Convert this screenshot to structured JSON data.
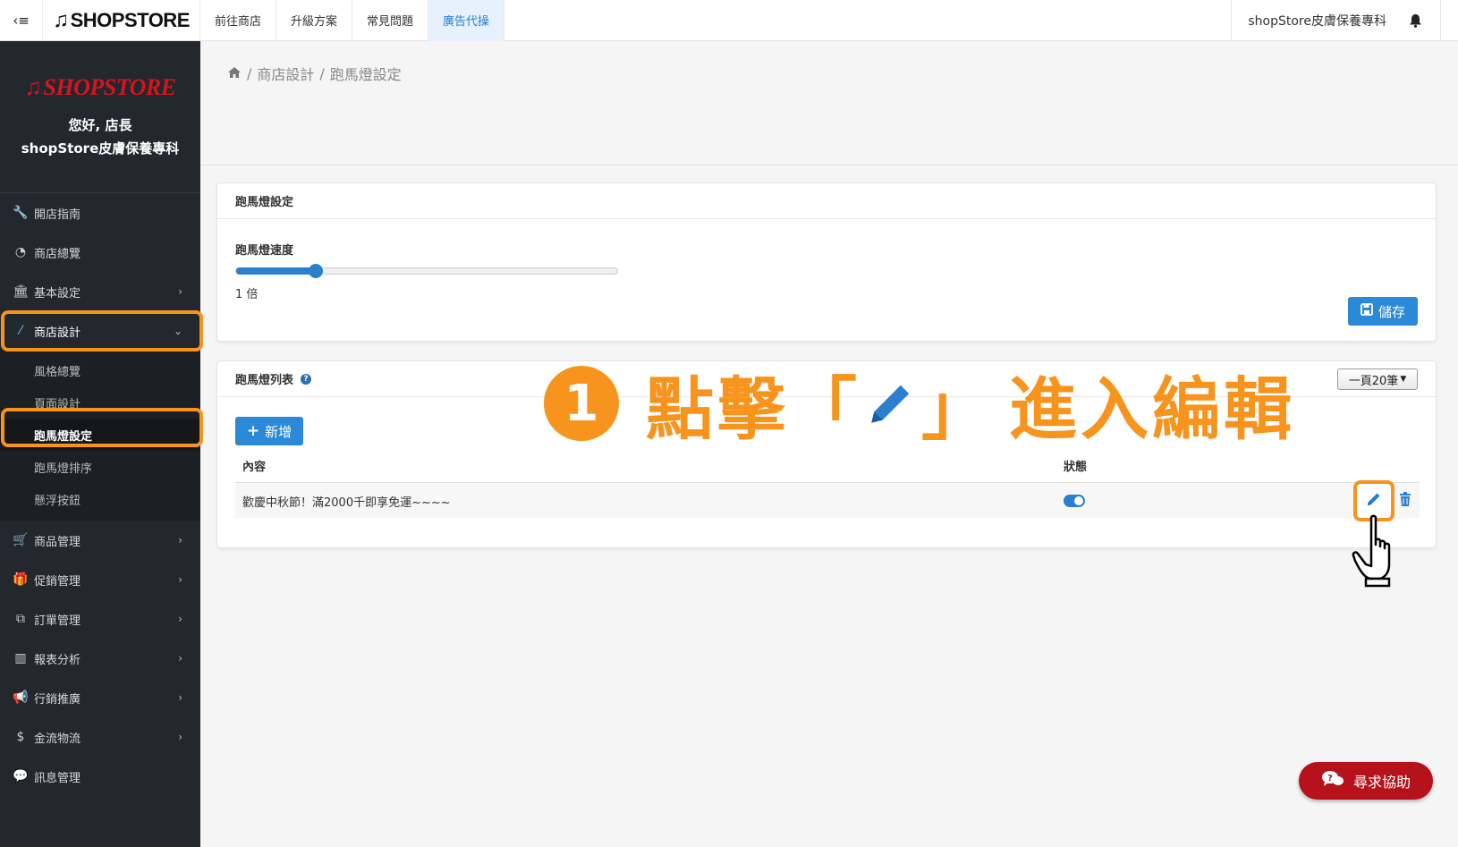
{
  "topbar": {
    "brand": "SHOPSTORE",
    "nav": [
      "前往商店",
      "升級方案",
      "常見問題",
      "廣告代操"
    ],
    "store_name": "shopStore皮膚保養專科"
  },
  "sidebar": {
    "brand": "SHOPSTORE",
    "greeting": "您好, 店長",
    "store_name": "shopStore皮膚保養專科",
    "items": [
      {
        "label": "開店指南",
        "icon": "wrench-icon"
      },
      {
        "label": "商店總覽",
        "icon": "dashboard-icon"
      },
      {
        "label": "基本設定",
        "icon": "bank-icon"
      },
      {
        "label": "商店設計",
        "icon": "magic-wand-icon"
      },
      {
        "label": "商品管理",
        "icon": "cart-icon"
      },
      {
        "label": "促銷管理",
        "icon": "gift-icon"
      },
      {
        "label": "訂單管理",
        "icon": "copy-icon"
      },
      {
        "label": "報表分析",
        "icon": "bar-chart-icon"
      },
      {
        "label": "行銷推廣",
        "icon": "bullhorn-icon"
      },
      {
        "label": "金流物流",
        "icon": "dollar-icon"
      },
      {
        "label": "訊息管理",
        "icon": "comments-icon"
      }
    ],
    "submenu": [
      "風格總覽",
      "頁面設計",
      "跑馬燈設定",
      "跑馬燈排序",
      "懸浮按鈕"
    ]
  },
  "breadcrumb": {
    "sep": "/",
    "items": [
      "商店設計",
      "跑馬燈設定"
    ]
  },
  "settings_panel": {
    "title": "跑馬燈設定",
    "speed_label": "跑馬燈速度",
    "speed_value_text": "1 倍",
    "speed_fraction": 0.21,
    "save_label": "儲存"
  },
  "list_panel": {
    "title": "跑馬燈列表",
    "page_size": "一頁20筆",
    "add_label": "新增",
    "columns": [
      "內容",
      "狀態"
    ],
    "rows": [
      {
        "content": "歡慶中秋節！滿2000千即享免運~~~~",
        "enabled": true
      }
    ]
  },
  "annotation": {
    "step": "1",
    "text_before": "點擊",
    "open_bracket": "「",
    "close_bracket": "」",
    "text_after": "進入編輯"
  },
  "help_button": "尋求協助",
  "colors": {
    "accent": "#2a8ad8",
    "highlight": "#f7941d",
    "sidebar": "#23272e",
    "help": "#b5121b"
  }
}
